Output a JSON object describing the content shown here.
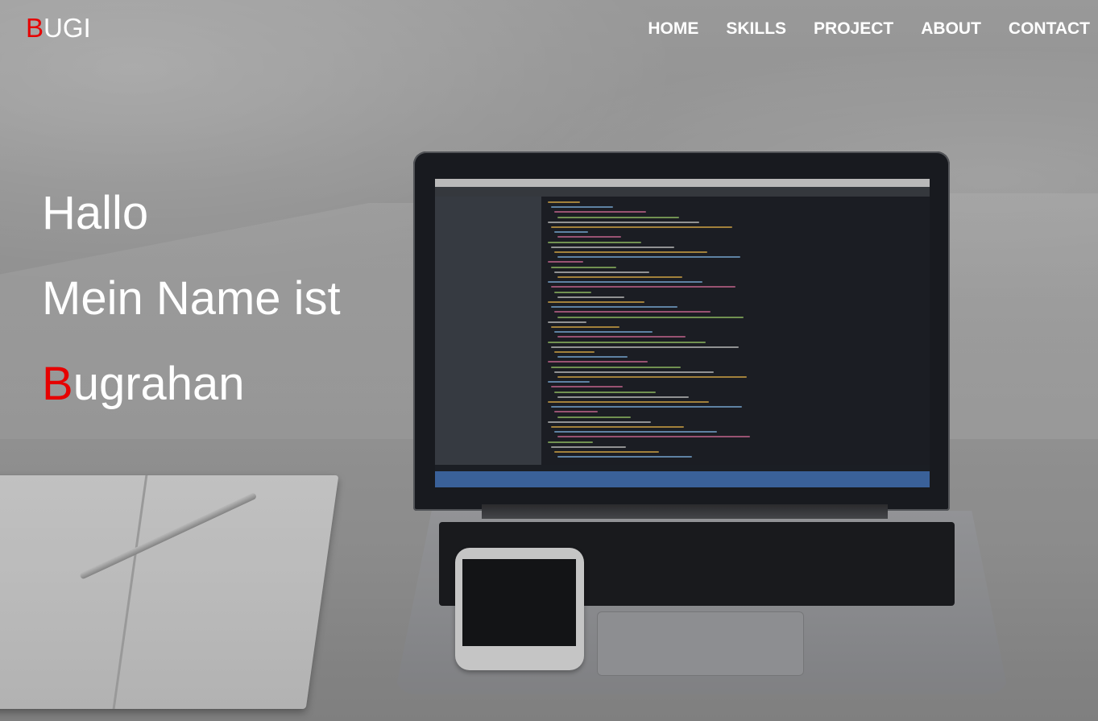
{
  "brand": {
    "accent_letter": "B",
    "rest": "UGI"
  },
  "nav": {
    "items": [
      {
        "label": "HOME"
      },
      {
        "label": "SKILLS"
      },
      {
        "label": "PROJECT"
      },
      {
        "label": "ABOUT"
      },
      {
        "label": "CONTACT"
      }
    ]
  },
  "hero": {
    "line1": "Hallo",
    "line2": "Mein Name ist",
    "name_accent": "B",
    "name_rest": "ugrahan"
  },
  "colors": {
    "accent": "#e60000",
    "text": "#ffffff"
  },
  "background": {
    "image": "laptop-desk-photo"
  }
}
